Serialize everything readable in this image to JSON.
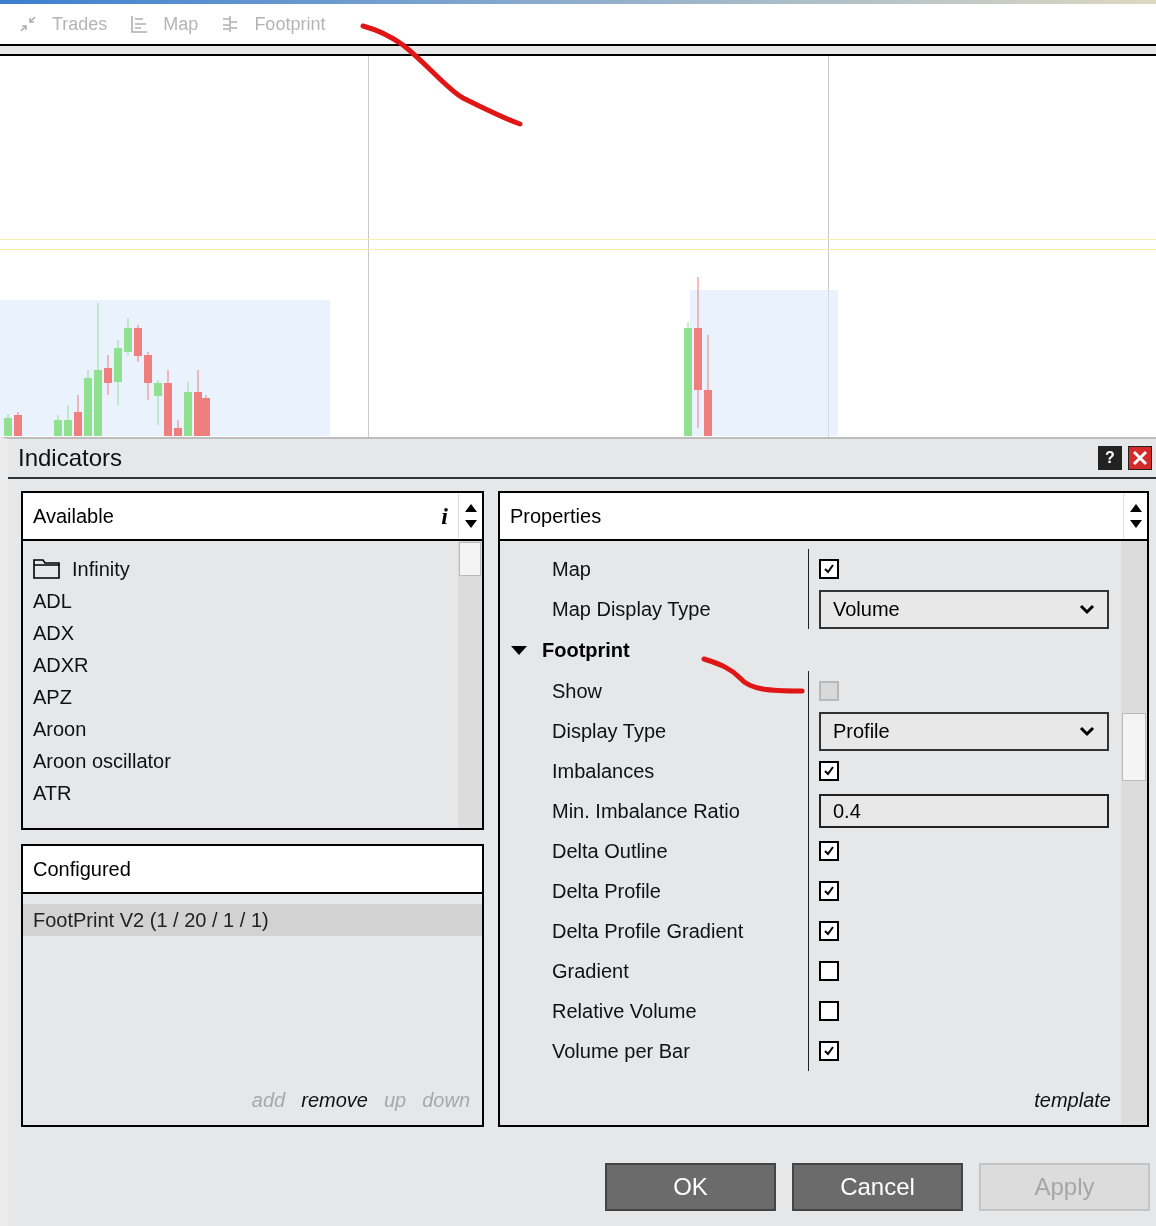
{
  "toolbar": {
    "items": [
      {
        "label": "Trades",
        "kind": "trades"
      },
      {
        "label": "Map",
        "kind": "map"
      },
      {
        "label": "Footprint",
        "kind": "footprint"
      }
    ]
  },
  "dialog": {
    "title": "Indicators",
    "help_button": "?",
    "available": {
      "title": "Available",
      "info": "i",
      "items": [
        {
          "label": "Infinity",
          "kind": "folder"
        },
        {
          "label": "ADL",
          "kind": "item"
        },
        {
          "label": "ADX",
          "kind": "item"
        },
        {
          "label": "ADXR",
          "kind": "item"
        },
        {
          "label": "APZ",
          "kind": "item"
        },
        {
          "label": "Aroon",
          "kind": "item"
        },
        {
          "label": "Aroon oscillator",
          "kind": "item"
        },
        {
          "label": "ATR",
          "kind": "item"
        }
      ]
    },
    "configured": {
      "title": "Configured",
      "items": [
        {
          "label": "FootPrint V2 (1 / 20 / 1 / 1)",
          "selected": true
        }
      ],
      "actions": [
        {
          "label": "add",
          "disabled": true
        },
        {
          "label": "remove",
          "disabled": false
        },
        {
          "label": "up",
          "disabled": true
        },
        {
          "label": "down",
          "disabled": true
        }
      ]
    },
    "properties": {
      "title": "Properties",
      "rows": [
        {
          "kind": "checkbox",
          "label": "Map",
          "checked": true,
          "disabled": false
        },
        {
          "kind": "dropdown",
          "label": "Map Display Type",
          "value": "Volume"
        },
        {
          "kind": "group",
          "label": "Footprint",
          "expanded": true,
          "children": [
            {
              "kind": "checkbox",
              "label": "Show",
              "checked": false,
              "disabled": true
            },
            {
              "kind": "dropdown",
              "label": "Display Type",
              "value": "Profile"
            },
            {
              "kind": "checkbox",
              "label": "Imbalances",
              "checked": true,
              "disabled": false
            },
            {
              "kind": "text",
              "label": "Min. Imbalance Ratio",
              "value": "0.4"
            },
            {
              "kind": "checkbox",
              "label": "Delta Outline",
              "checked": true,
              "disabled": false
            },
            {
              "kind": "checkbox",
              "label": "Delta Profile",
              "checked": true,
              "disabled": false
            },
            {
              "kind": "checkbox",
              "label": "Delta Profile Gradient",
              "checked": true,
              "disabled": false
            },
            {
              "kind": "checkbox",
              "label": "Gradient",
              "checked": false,
              "disabled": false
            },
            {
              "kind": "checkbox",
              "label": "Relative Volume",
              "checked": false,
              "disabled": false
            },
            {
              "kind": "checkbox",
              "label": "Volume per Bar",
              "checked": true,
              "disabled": false
            }
          ]
        }
      ],
      "template": "template"
    },
    "buttons": [
      {
        "label": "OK",
        "disabled": false
      },
      {
        "label": "Cancel",
        "disabled": false
      },
      {
        "label": "Apply",
        "disabled": true
      }
    ]
  }
}
